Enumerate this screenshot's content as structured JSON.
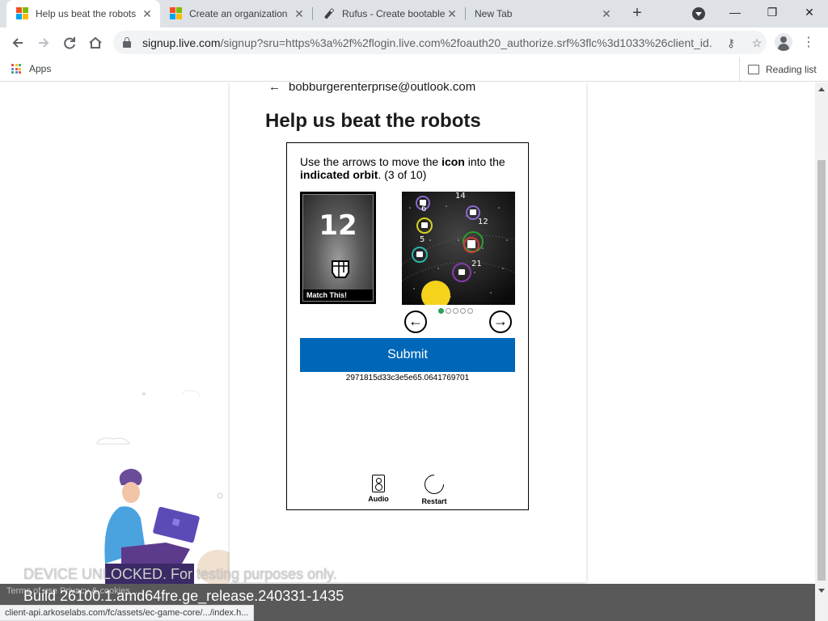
{
  "tabs": [
    {
      "title": "Help us beat the robots",
      "favicon": "microsoft-logo",
      "active": true
    },
    {
      "title": "Create an organization",
      "favicon": "microsoft-logo",
      "active": false
    },
    {
      "title": "Rufus - Create bootable",
      "favicon": "usb-drive-icon",
      "active": false
    },
    {
      "title": "New Tab",
      "favicon": "none",
      "active": false
    }
  ],
  "new_tab_label": "+",
  "window": {
    "minimize": "—",
    "maximize": "❐",
    "close": "✕"
  },
  "toolbar": {
    "url_host": "signup.live.com",
    "url_rest": "/signup?sru=https%3a%2f%2flogin.live.com%2foauth20_authorize.srf%3flc%3d1033%26client_id..."
  },
  "bookmarks": {
    "apps_label": "Apps",
    "reading_list_label": "Reading list"
  },
  "signup": {
    "email": "bobburgerenterprise@outlook.com",
    "title": "Help us beat the robots"
  },
  "puzzle": {
    "instruction_pre": "Use the arrows to move the ",
    "instruction_bold1": "icon",
    "instruction_mid": " into the ",
    "instruction_bold2": "indicated orbit",
    "instruction_post": ". (3 of 10)",
    "match_number": "12",
    "match_label": "Match This!",
    "orbit_numbers": [
      "14",
      "6",
      "12",
      "5",
      "21"
    ],
    "active_dot_index": 0,
    "dot_count": 5,
    "submit_label": "Submit",
    "session_id": "2971815d33c3e5e65.0641769701",
    "audio_label": "Audio",
    "restart_label": "Restart"
  },
  "footer": {
    "terms": "Terms of use   Privacy & cookies   ...",
    "watermark_line1": "DEVICE UNLOCKED. For testing purposes only.",
    "watermark_line2": "Build 26100.1.amd64fre.ge_release.240331-1435",
    "status_url": "client-api.arkoselabs.com/fc/assets/ec-game-core/.../index.h..."
  },
  "colors": {
    "submit_bg": "#0067b8",
    "tabstrip_bg": "#dee1e6",
    "footer_bg": "#595959"
  }
}
